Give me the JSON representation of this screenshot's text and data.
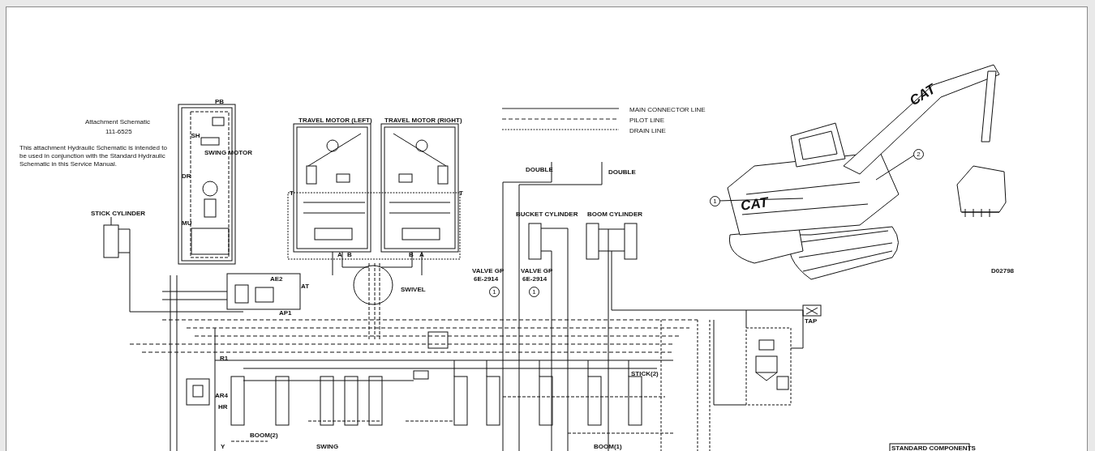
{
  "attachment_note": {
    "title": "Attachment Schematic",
    "number": "111-6525",
    "description": "This attachment Hydraulic Schematic is intended to be used in conjunction with the Standard Hydraulic Schematic in this Service Manual."
  },
  "legend": [
    {
      "kind": "main",
      "label": "MAIN CONNECTOR LINE"
    },
    {
      "kind": "pilot",
      "label": "PILOT LINE"
    },
    {
      "kind": "drain",
      "label": "DRAIN LINE"
    }
  ],
  "schematic_labels": [
    {
      "text": "PB"
    },
    {
      "text": "TRAVEL MOTOR (LEFT)"
    },
    {
      "text": "TRAVEL MOTOR (RIGHT)"
    },
    {
      "text": "SH"
    },
    {
      "text": "SWING MOTOR"
    },
    {
      "text": "DOUBLE"
    },
    {
      "text": "DOUBLE"
    },
    {
      "text": "DR"
    },
    {
      "text": "T"
    },
    {
      "text": "T"
    },
    {
      "text": "STICK CYLINDER"
    },
    {
      "text": "BUCKET CYLINDER"
    },
    {
      "text": "BOOM CYLINDER"
    },
    {
      "text": "MU"
    },
    {
      "text": "A"
    },
    {
      "text": "B"
    },
    {
      "text": "B"
    },
    {
      "text": "A"
    },
    {
      "text": "VALVE GP"
    },
    {
      "text": "VALVE GP"
    },
    {
      "text": "D02798"
    },
    {
      "text": "AE2"
    },
    {
      "text": "6E-2914"
    },
    {
      "text": "6E-2914"
    },
    {
      "text": "AT"
    },
    {
      "text": "SWIVEL"
    },
    {
      "text": "AP1"
    },
    {
      "text": "TAP"
    },
    {
      "text": "R1"
    },
    {
      "text": "STICK(2)"
    },
    {
      "text": "AR4"
    },
    {
      "text": "HR"
    },
    {
      "text": "BOOM(2)"
    },
    {
      "text": "Y"
    },
    {
      "text": "SWING"
    },
    {
      "text": "BOOM(1)"
    },
    {
      "text": "STANDARD COMPONENTS"
    }
  ],
  "callouts": [
    {
      "number": "2"
    },
    {
      "number": "1"
    },
    {
      "number": "1"
    },
    {
      "number": "1"
    }
  ],
  "machine_markings": [
    "CAT",
    "CAT"
  ]
}
